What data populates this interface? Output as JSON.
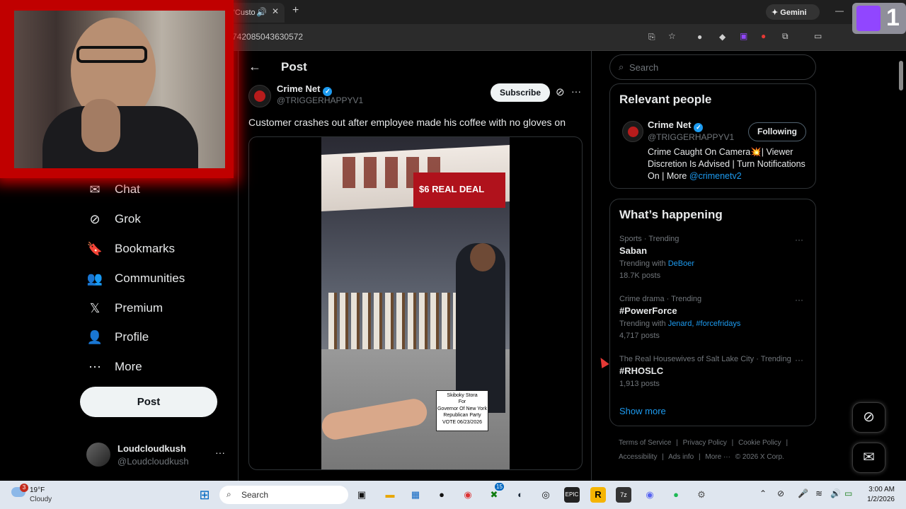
{
  "browser": {
    "tab_title": "\"Custo",
    "new_tab": "+",
    "url": "742085043630572",
    "gemini_label": "Gemini",
    "gemini_icon": "sparkle-icon"
  },
  "twitch_overlay": {
    "count": "1"
  },
  "nav": {
    "items": [
      {
        "label": "Chat",
        "icon": "envelope-icon",
        "glyph": "✉"
      },
      {
        "label": "Grok",
        "icon": "grok-icon",
        "glyph": "⊘"
      },
      {
        "label": "Bookmarks",
        "icon": "bookmark-icon",
        "glyph": "🔖"
      },
      {
        "label": "Communities",
        "icon": "communities-icon",
        "glyph": "👥"
      },
      {
        "label": "Premium",
        "icon": "x-logo-icon",
        "glyph": "𝕏"
      },
      {
        "label": "Profile",
        "icon": "profile-icon",
        "glyph": "👤"
      },
      {
        "label": "More",
        "icon": "more-circle-icon",
        "glyph": "⋯"
      }
    ],
    "post_button": "Post"
  },
  "account": {
    "name": "Loudcloudkush",
    "handle": "@Loudcloudkush",
    "more": "···"
  },
  "post": {
    "header": "Post",
    "author_name": "Crime Net",
    "author_handle": "@TRIGGERHAPPYV1",
    "subscribe_label": "Subscribe",
    "more": "···",
    "text": "Customer crashes out after employee made his coffee with no gloves on",
    "video_sign_text": [
      "Skiboky Stora",
      "For",
      "Governor Of New York",
      "Republican Party",
      "VOTE 06/23/2026"
    ],
    "menu_board_text": "$6 REAL DEAL"
  },
  "search": {
    "placeholder": "Search"
  },
  "relevant_people": {
    "title": "Relevant people",
    "name": "Crime Net",
    "handle": "@TRIGGERHAPPYV1",
    "follow_label": "Following",
    "bio": "Crime Caught On Camera💥| Viewer Discretion Is Advised | Turn Notifications On | More ",
    "bio_link": "@crimenetv2"
  },
  "whats_happening": {
    "title": "What’s happening",
    "trends": [
      {
        "meta": "Sports · Trending",
        "title": "Saban",
        "with_prefix": "Trending with ",
        "with_links": "DeBoer",
        "count": "18.7K posts"
      },
      {
        "meta": "Crime drama · Trending",
        "title": "#PowerForce",
        "with_prefix": "Trending with ",
        "with_links": "Jenard, #forcefridays",
        "count": "4,717 posts"
      },
      {
        "meta": "The Real Housewives of Salt Lake City · Trending",
        "title": "#RHOSLC",
        "with_prefix": "",
        "with_links": "",
        "count": "1,913 posts"
      }
    ],
    "show_more": "Show more",
    "more": "···"
  },
  "footer": {
    "links": [
      "Terms of Service",
      "|",
      "Privacy Policy",
      "|",
      "Cookie Policy",
      "|"
    ],
    "links2": [
      "Accessibility",
      "|",
      "Ads info",
      "|",
      "More ···",
      "© 2026 X Corp."
    ]
  },
  "floating": {
    "grok_icon": "grok-icon",
    "messages_icon": "envelope-icon"
  },
  "taskbar": {
    "weather_temp": "19°F",
    "weather_cond": "Cloudy",
    "weather_badge": "3",
    "search_placeholder": "Search",
    "time": "3:00 AM",
    "date": "1/2/2026",
    "xbox_badge": "15"
  }
}
